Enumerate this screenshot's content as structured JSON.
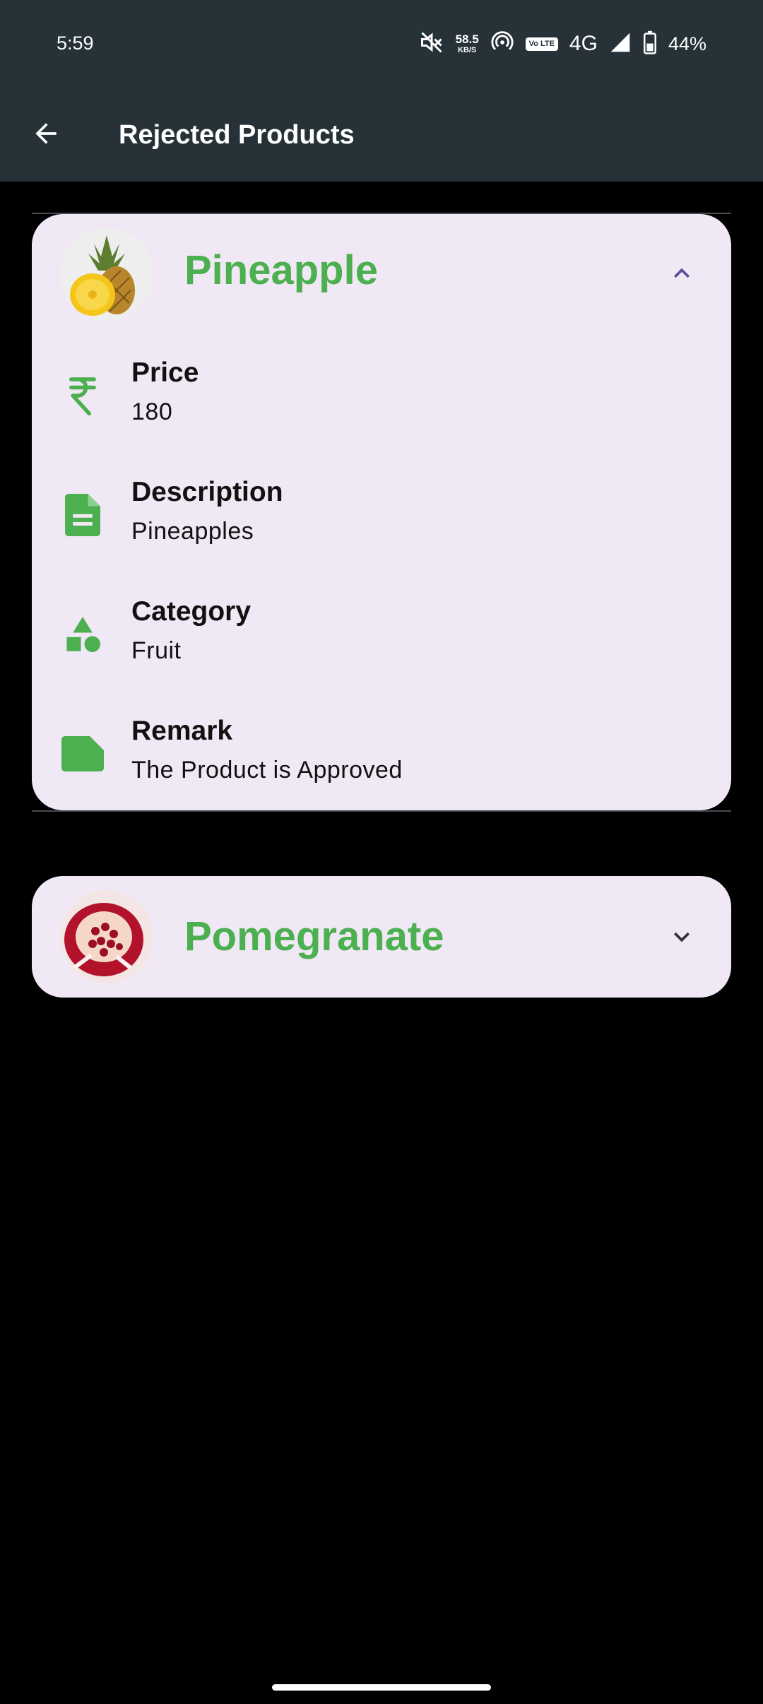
{
  "status_bar": {
    "time": "5:59",
    "net_speed_value": "58.5",
    "net_speed_unit": "KB/S",
    "volte_label": "Vo LTE",
    "network_type": "4G",
    "battery_percent": "44%",
    "icons": [
      "mute-icon",
      "hotspot-icon",
      "volte-icon",
      "signal-icon",
      "battery-icon"
    ]
  },
  "app_bar": {
    "title": "Rejected Products",
    "back_icon": "arrow-back-icon"
  },
  "products": [
    {
      "name": "Pineapple",
      "expanded": true,
      "details": {
        "price": {
          "label": "Price",
          "value": "180",
          "icon": "rupee-icon"
        },
        "description": {
          "label": "Description",
          "value": "Pineapples",
          "icon": "document-icon"
        },
        "category": {
          "label": "Category",
          "value": "Fruit",
          "icon": "category-icon"
        },
        "remark": {
          "label": "Remark",
          "value": "The Product is Approved",
          "icon": "note-icon"
        }
      }
    },
    {
      "name": "Pomegranate",
      "expanded": false
    }
  ],
  "colors": {
    "app_bar": "#263238",
    "card_bg": "#f0e9f5",
    "accent_green": "#4caf50",
    "chevron_up": "#5e4b9c",
    "page_bg": "#000000"
  }
}
